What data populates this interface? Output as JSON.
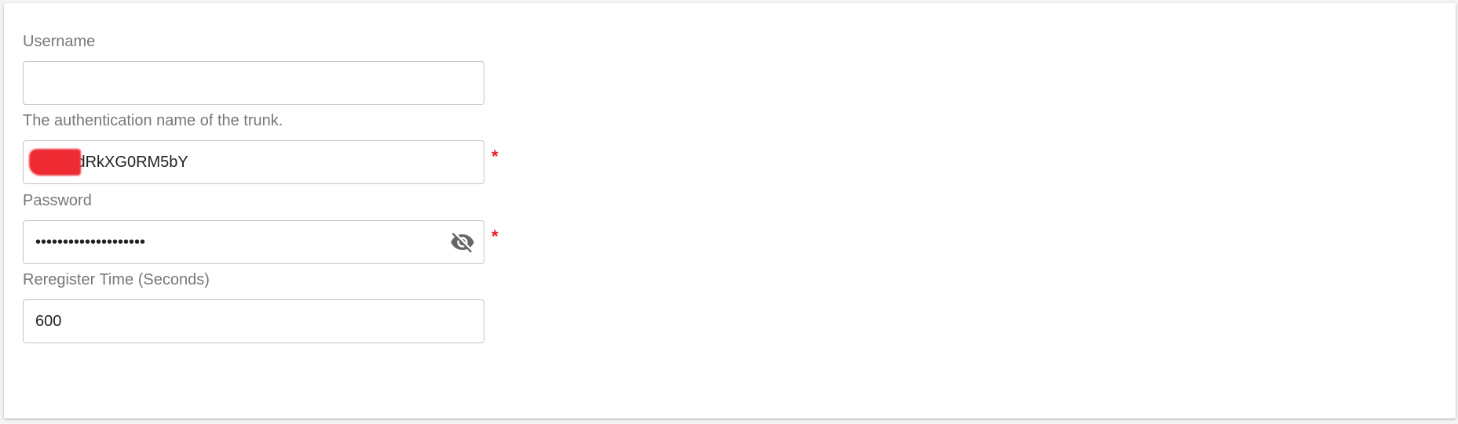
{
  "form": {
    "username": {
      "label": "Username",
      "value": ""
    },
    "auth_name": {
      "label": "The authentication name of the trunk.",
      "value": "V       3dRkXG0RM5bY",
      "required_mark": "*"
    },
    "password": {
      "label": "Password",
      "value": "••••••••••••••••••••",
      "required_mark": "*",
      "toggle_icon": "eye-off-icon"
    },
    "reregister": {
      "label": "Reregister Time (Seconds)",
      "value": "600"
    }
  },
  "colors": {
    "label": "#777777",
    "border": "#c4c4c4",
    "required": "#e0202a",
    "redaction": "#ee2a33",
    "icon": "#666666"
  }
}
